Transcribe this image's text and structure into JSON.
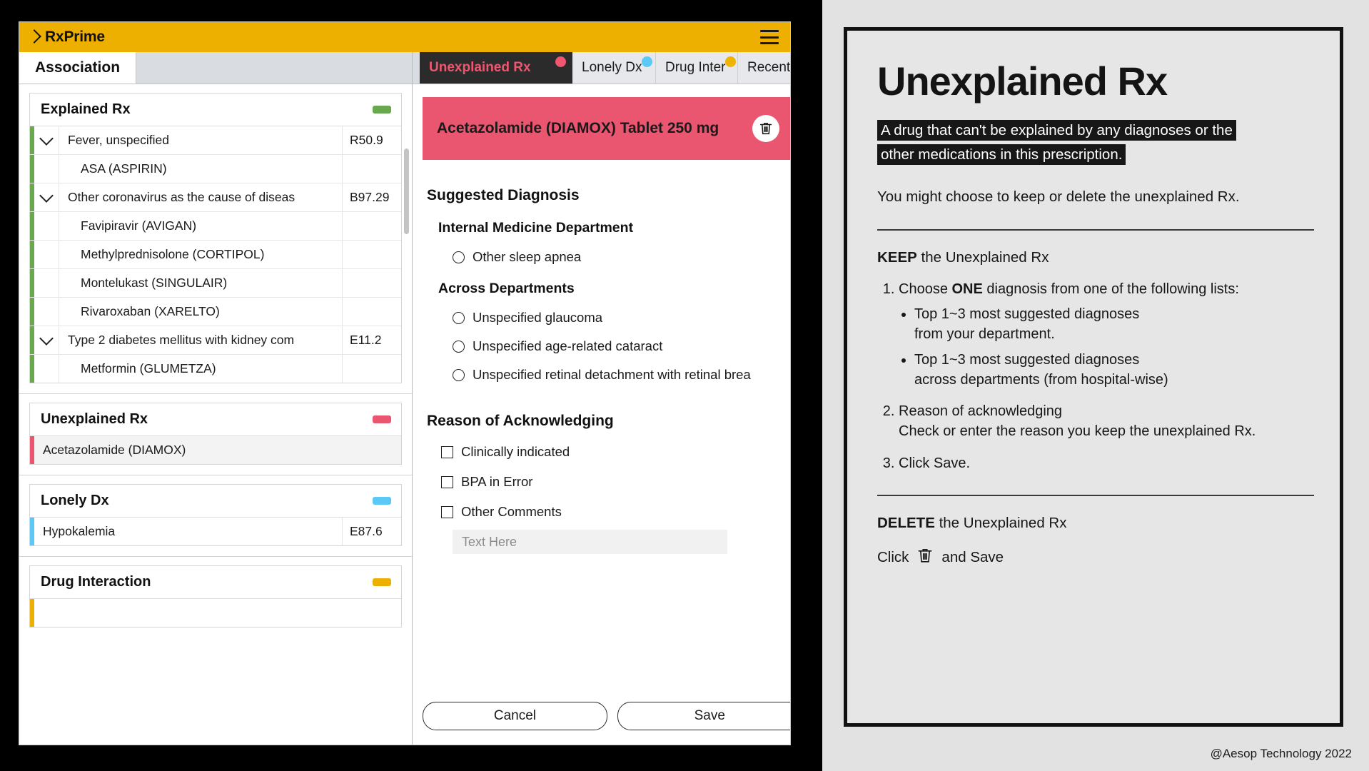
{
  "app": {
    "brand": "RxPrime",
    "menu_icon": "hamburger-icon",
    "left_tab": "Association",
    "tabs": [
      {
        "label": "Unexplained Rx",
        "dot": "pink",
        "active": true
      },
      {
        "label": "Lonely Dx",
        "dot": "blue",
        "active": false
      },
      {
        "label": "Drug Inter",
        "dot": "amber",
        "active": false
      },
      {
        "label": "Recent Rx",
        "dot": "",
        "active": false
      }
    ]
  },
  "left_panel": {
    "cards": [
      {
        "title": "Explained Rx",
        "pill": "green",
        "rows": [
          {
            "caret": true,
            "name": "Fever, unspecified",
            "code": "R50.9",
            "indent": false
          },
          {
            "caret": false,
            "name": "ASA (ASPIRIN)",
            "code": "",
            "indent": true
          },
          {
            "caret": true,
            "name": "Other coronavirus as the cause of diseas",
            "code": "B97.29",
            "indent": false
          },
          {
            "caret": false,
            "name": "Favipiravir (AVIGAN)",
            "code": "",
            "indent": true
          },
          {
            "caret": false,
            "name": "Methylprednisolone (CORTIPOL)",
            "code": "",
            "indent": true
          },
          {
            "caret": false,
            "name": "Montelukast (SINGULAIR)",
            "code": "",
            "indent": true
          },
          {
            "caret": false,
            "name": "Rivaroxaban (XARELTO)",
            "code": "",
            "indent": true
          },
          {
            "caret": true,
            "name": "Type 2 diabetes mellitus with kidney com",
            "code": "E11.2",
            "indent": false
          },
          {
            "caret": false,
            "name": "Metformin (GLUMETZA)",
            "code": "",
            "indent": true
          }
        ]
      },
      {
        "title": "Unexplained Rx",
        "pill": "pink",
        "rows": [
          {
            "caret": false,
            "name": "Acetazolamide (DIAMOX)",
            "code": "",
            "indent": false,
            "shaded": true
          }
        ]
      },
      {
        "title": "Lonely Dx",
        "pill": "blue",
        "rows": [
          {
            "caret": false,
            "name": "Hypokalemia",
            "code": "E87.6",
            "indent": false
          }
        ]
      },
      {
        "title": "Drug Interaction",
        "pill": "amber",
        "rows": [
          {
            "caret": false,
            "name": "",
            "code": "",
            "indent": false
          }
        ]
      }
    ]
  },
  "detail": {
    "drug_name": "Acetazolamide (DIAMOX) Tablet 250 mg",
    "delete_icon": "trash-icon",
    "suggested_heading": "Suggested Diagnosis",
    "groups": [
      {
        "heading": "Internal Medicine Department",
        "options": [
          "Other sleep apnea"
        ]
      },
      {
        "heading": "Across Departments",
        "options": [
          "Unspecified glaucoma",
          "Unspecified age-related cataract",
          "Unspecified retinal detachment with retinal brea"
        ]
      }
    ],
    "reason_heading": "Reason of Acknowledging",
    "checkboxes": [
      "Clinically indicated",
      "BPA in Error",
      "Other Comments"
    ],
    "comment_placeholder": "Text Here",
    "cancel_label": "Cancel",
    "save_label": "Save"
  },
  "slide": {
    "title": "Unexplained Rx",
    "definition_line1": "A drug that can't be explained by any diagnoses or the",
    "definition_line2": "other medications in this prescription.",
    "intro": "You might choose to keep or delete the unexplained Rx.",
    "keep_bold": "KEEP",
    "keep_rest": " the Unexplained Rx",
    "step1_a": "Choose ",
    "step1_bold": "ONE",
    "step1_b": " diagnosis from one of the following lists:",
    "bullet1_line1": "Top 1~3 most suggested diagnoses",
    "bullet1_line2": "from your department.",
    "bullet2_line1": "Top 1~3 most suggested diagnoses",
    "bullet2_line2": "across departments (from hospital-wise)",
    "step2_line1": "Reason of acknowledging",
    "step2_line2": "Check or enter the reason you keep the unexplained Rx.",
    "step3": "Click Save.",
    "delete_bold": "DELETE",
    "delete_rest": " the Unexplained Rx",
    "click_pre": "Click",
    "click_post": "and Save",
    "trash_icon": "trash-icon",
    "credit": "@Aesop Technology 2022"
  },
  "colors": {
    "brand_yellow": "#eeb000",
    "pink": "#ea5570",
    "green": "#6aa84f",
    "blue": "#5bc8f5"
  }
}
